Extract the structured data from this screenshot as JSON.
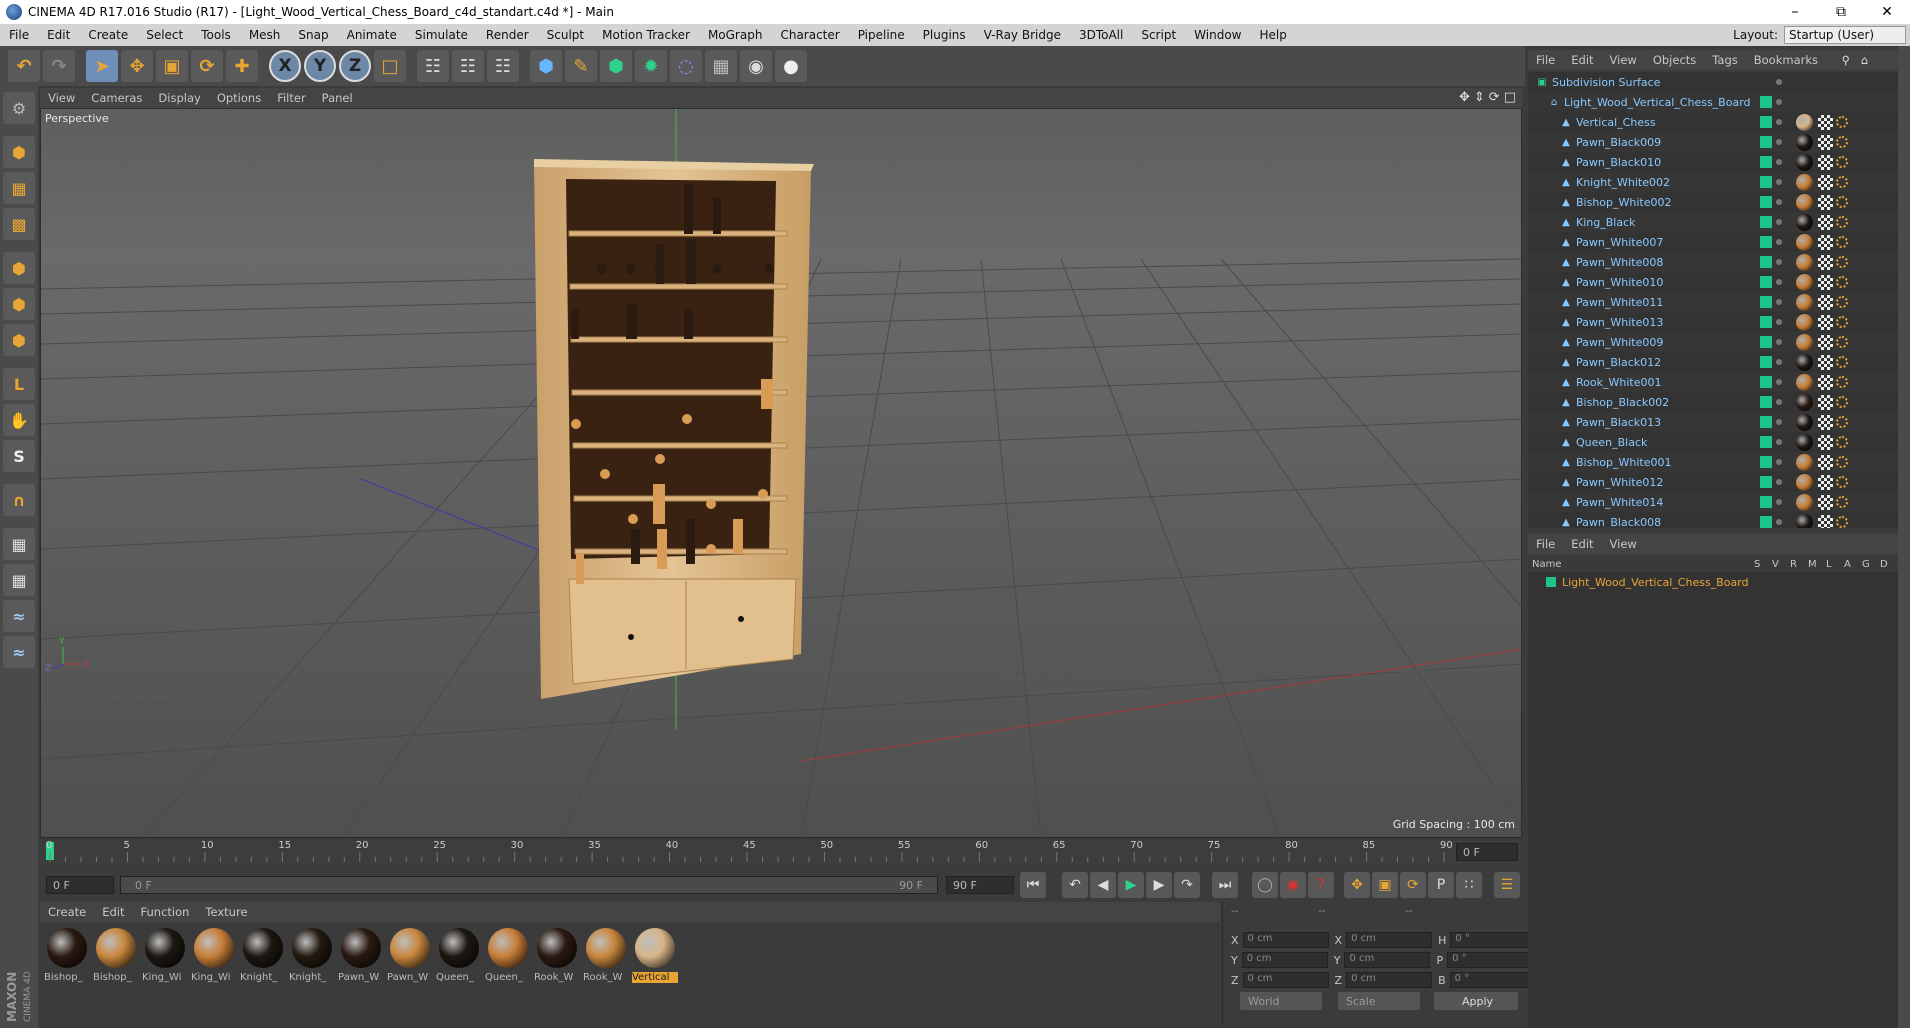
{
  "window": {
    "title": "CINEMA 4D R17.016 Studio (R17) - [Light_Wood_Vertical_Chess_Board_c4d_standart.c4d *] - Main",
    "minimize": "–",
    "restore": "⧉",
    "close": "✕"
  },
  "menubar": {
    "items": [
      "File",
      "Edit",
      "Create",
      "Select",
      "Tools",
      "Mesh",
      "Snap",
      "Animate",
      "Simulate",
      "Render",
      "Sculpt",
      "Motion Tracker",
      "MoGraph",
      "Character",
      "Pipeline",
      "Plugins",
      "V-Ray Bridge",
      "3DToAll",
      "Script",
      "Window",
      "Help"
    ],
    "layout_label": "Layout:",
    "layout_value": "Startup (User)"
  },
  "toolbar": {
    "axis_x": "X",
    "axis_y": "Y",
    "axis_z": "Z"
  },
  "viewport": {
    "menu": [
      "View",
      "Cameras",
      "Display",
      "Options",
      "Filter",
      "Panel"
    ],
    "label": "Perspective",
    "grid_spacing": "Grid Spacing : 100 cm"
  },
  "timeline": {
    "ticks": [
      "0",
      "5",
      "10",
      "15",
      "20",
      "25",
      "30",
      "35",
      "40",
      "45",
      "50",
      "55",
      "60",
      "65",
      "70",
      "75",
      "80",
      "85",
      "90"
    ],
    "current_frame": "0 F",
    "start_frame": "0 F",
    "slider_start": "0 F",
    "slider_end": "90 F",
    "end_frame": "90 F"
  },
  "materials": {
    "menu": [
      "Create",
      "Edit",
      "Function",
      "Texture"
    ],
    "items": [
      {
        "label": "Bishop_",
        "color": "#2a1a12"
      },
      {
        "label": "Bishop_",
        "color": "#c8873f"
      },
      {
        "label": "King_Wi",
        "color": "#1d1711"
      },
      {
        "label": "King_Wi",
        "color": "#c77e38"
      },
      {
        "label": "Knight_",
        "color": "#1d1711"
      },
      {
        "label": "Knight_",
        "color": "#241a10"
      },
      {
        "label": "Pawn_W",
        "color": "#2a1a12"
      },
      {
        "label": "Pawn_W",
        "color": "#c8873f"
      },
      {
        "label": "Queen_",
        "color": "#1d1711"
      },
      {
        "label": "Queen_",
        "color": "#c77e38"
      },
      {
        "label": "Rook_W",
        "color": "#2a1a12"
      },
      {
        "label": "Rook_W",
        "color": "#c8873f"
      },
      {
        "label": "Vertical",
        "color": "#d8b58a"
      }
    ]
  },
  "coords": {
    "header": [
      "--",
      "--",
      "--"
    ],
    "rows": [
      {
        "a": "X",
        "av": "0 cm",
        "b": "X",
        "bv": "0 cm",
        "c": "H",
        "cv": "0 °"
      },
      {
        "a": "Y",
        "av": "0 cm",
        "b": "Y",
        "bv": "0 cm",
        "c": "P",
        "cv": "0 °"
      },
      {
        "a": "Z",
        "av": "0 cm",
        "b": "Z",
        "bv": "0 cm",
        "c": "B",
        "cv": "0 °"
      }
    ],
    "mode": "World",
    "scale": "Scale",
    "apply": "Apply"
  },
  "objects": {
    "menu": [
      "File",
      "Edit",
      "View",
      "Objects",
      "Tags",
      "Bookmarks"
    ],
    "items": [
      {
        "name": "Subdivision Surface",
        "indent": 0,
        "mat": ""
      },
      {
        "name": "Light_Wood_Vertical_Chess_Board",
        "indent": 1,
        "mat": ""
      },
      {
        "name": "Vertical_Chess",
        "indent": 2,
        "mat": "#d8b58a"
      },
      {
        "name": "Pawn_Black009",
        "indent": 2,
        "mat": "#1d1711"
      },
      {
        "name": "Pawn_Black010",
        "indent": 2,
        "mat": "#1d1711"
      },
      {
        "name": "Knight_White002",
        "indent": 2,
        "mat": "#c77e38"
      },
      {
        "name": "Bishop_White002",
        "indent": 2,
        "mat": "#c77e38"
      },
      {
        "name": "King_Black",
        "indent": 2,
        "mat": "#1d1711"
      },
      {
        "name": "Pawn_White007",
        "indent": 2,
        "mat": "#c77e38"
      },
      {
        "name": "Pawn_White008",
        "indent": 2,
        "mat": "#c77e38"
      },
      {
        "name": "Pawn_White010",
        "indent": 2,
        "mat": "#c77e38"
      },
      {
        "name": "Pawn_White011",
        "indent": 2,
        "mat": "#c77e38"
      },
      {
        "name": "Pawn_White013",
        "indent": 2,
        "mat": "#c77e38"
      },
      {
        "name": "Pawn_White009",
        "indent": 2,
        "mat": "#c77e38"
      },
      {
        "name": "Pawn_Black012",
        "indent": 2,
        "mat": "#1d1711"
      },
      {
        "name": "Rook_White001",
        "indent": 2,
        "mat": "#c77e38"
      },
      {
        "name": "Bishop_Black002",
        "indent": 2,
        "mat": "#2a1a12"
      },
      {
        "name": "Pawn_Black013",
        "indent": 2,
        "mat": "#1d1711"
      },
      {
        "name": "Queen_Black",
        "indent": 2,
        "mat": "#1d1711"
      },
      {
        "name": "Bishop_White001",
        "indent": 2,
        "mat": "#c77e38"
      },
      {
        "name": "Pawn_White012",
        "indent": 2,
        "mat": "#c77e38"
      },
      {
        "name": "Pawn_White014",
        "indent": 2,
        "mat": "#c77e38"
      },
      {
        "name": "Pawn_Black008",
        "indent": 2,
        "mat": "#1d1711"
      }
    ]
  },
  "attributes": {
    "menu": [
      "File",
      "Edit",
      "View"
    ],
    "columns": [
      "Name",
      "S",
      "V",
      "R",
      "M",
      "L",
      "A",
      "G",
      "D"
    ],
    "layer_name": "Light_Wood_Vertical_Chess_Board"
  },
  "brand": {
    "line1": "MAXON",
    "line2": "CINEMA 4D"
  },
  "colors": {
    "accent": "#e9a534",
    "tag_green": "#1ec58a",
    "object_blue": "#8ac9ff",
    "wood": "#d8b58a"
  }
}
